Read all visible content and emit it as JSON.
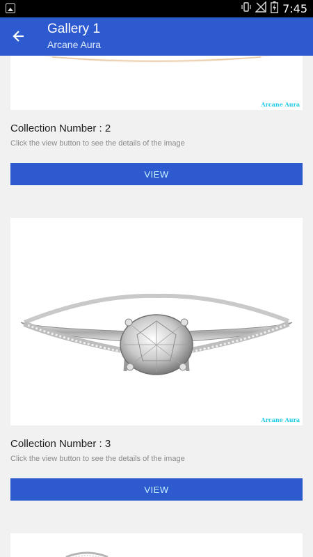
{
  "status_bar": {
    "time": "7:45"
  },
  "app_bar": {
    "title": "Gallery 1",
    "subtitle": "Arcane Aura"
  },
  "cards": [
    {
      "watermark": "Arcane Aura",
      "title": "Collection Number : 2",
      "description": "Click the view button to see the details of the image",
      "button_label": "VIEW"
    },
    {
      "watermark": "Arcane Aura",
      "title": "Collection Number : 3",
      "description": "Click the view button to see the details of the image",
      "button_label": "VIEW"
    }
  ],
  "colors": {
    "app_bar": "#2d5bcf",
    "page_background": "#5ff6f6",
    "card": "#f1f1f1",
    "watermark": "#1ec9e8"
  }
}
